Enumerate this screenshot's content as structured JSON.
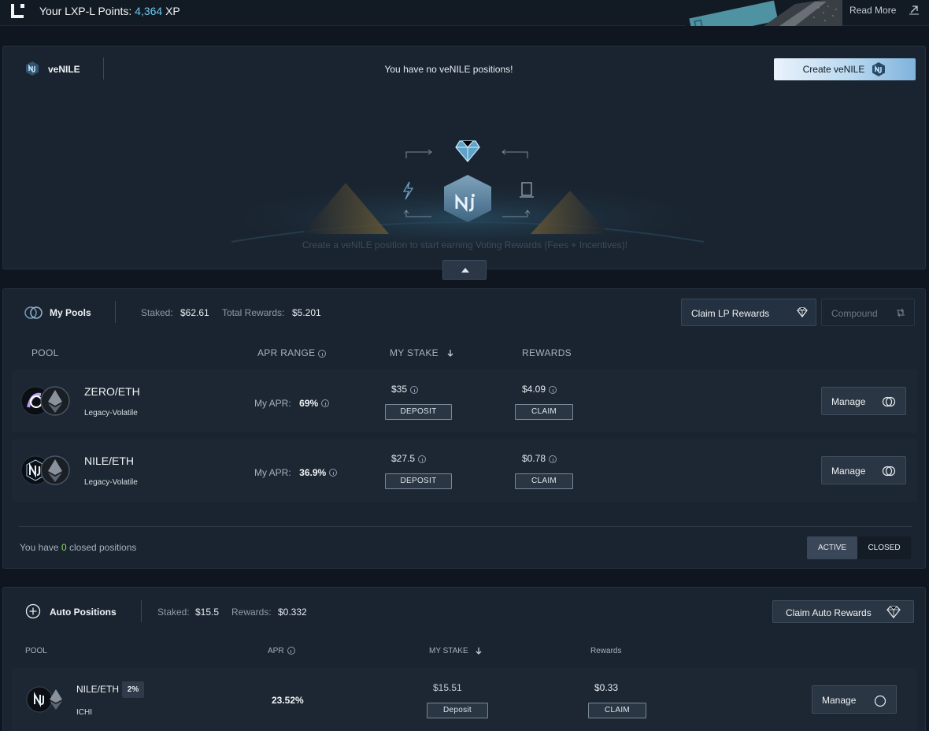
{
  "topbar": {
    "points_label": "Your LXP-L Points:",
    "points_value": "4,364",
    "points_unit": "XP",
    "read_more": "Read More",
    "banner_icon": "linea-lxp-banner"
  },
  "venile": {
    "title": "veNILE",
    "empty_message": "You have no veNILE positions!",
    "create_button": "Create veNILE",
    "hint": "Create a veNILE position to start earning Voting Rewards (Fees + Incentives)!",
    "illustration_icons": [
      "diamond-icon",
      "lightning-icon",
      "tablet-icon",
      "nile-logo-icon"
    ]
  },
  "my_pools": {
    "title": "My Pools",
    "staked_label": "Staked:",
    "staked_value": "$62.61",
    "rewards_label": "Total Rewards:",
    "rewards_value": "$5.201",
    "claim_button": "Claim LP Rewards",
    "compound_button": "Compound",
    "columns": {
      "pool": "POOL",
      "apr": "APR RANGE",
      "stake": "MY STAKE",
      "rewards": "REWARDS"
    },
    "rows": [
      {
        "name": "ZERO/ETH",
        "type": "Legacy-Volatile",
        "apr_label": "My APR:",
        "apr": "69%",
        "stake": "$35",
        "deposit": "DEPOSIT",
        "rewards": "$4.09",
        "claim": "CLAIM",
        "manage": "Manage"
      },
      {
        "name": "NILE/ETH",
        "type": "Legacy-Volatile",
        "apr_label": "My APR:",
        "apr": "36.9%",
        "stake": "$27.5",
        "deposit": "DEPOSIT",
        "rewards": "$0.78",
        "claim": "CLAIM",
        "manage": "Manage"
      }
    ],
    "closed_prefix": "You have",
    "closed_count": "0",
    "closed_suffix": "closed positions",
    "tab_active": "ACTIVE",
    "tab_closed": "CLOSED"
  },
  "auto_positions": {
    "title": "Auto Positions",
    "staked_label": "Staked:",
    "staked_value": "$15.5",
    "rewards_label": "Rewards:",
    "rewards_value": "$0.332",
    "claim_button": "Claim Auto Rewards",
    "columns": {
      "pool": "POOL",
      "apr": "APR",
      "stake": "MY STAKE",
      "rewards": "Rewards"
    },
    "rows": [
      {
        "name": "NILE/ETH",
        "fee": "2%",
        "provider": "ICHI",
        "apr": "23.52%",
        "stake": "$15.51",
        "deposit": "Deposit",
        "rewards": "$0.33",
        "claim": "CLAIM",
        "manage": "Manage"
      }
    ]
  },
  "colors": {
    "background": "#0f1620",
    "card": "#1a2430",
    "accent_xp": "#6ec9ee",
    "closed_count": "#8fd35a",
    "create_button_gradient_start": "#e8f2fb",
    "create_button_gradient_end": "#7fb3dc"
  }
}
